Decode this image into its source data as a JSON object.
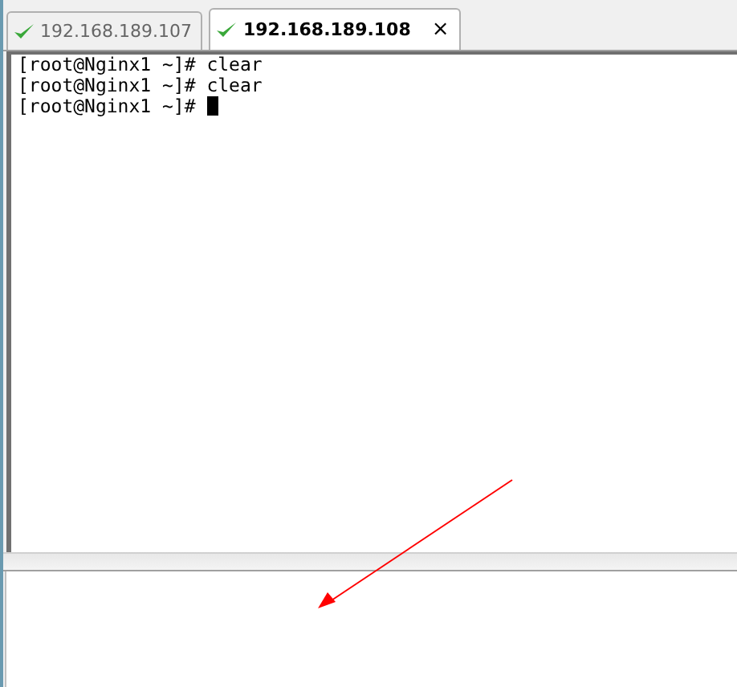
{
  "tabs": [
    {
      "label": "192.168.189.107",
      "selected": false
    },
    {
      "label": "192.168.189.108",
      "selected": true,
      "close": "×"
    }
  ],
  "terminal": {
    "lines": [
      "[root@Nginx1 ~]# clear",
      "[root@Nginx1 ~]# clear",
      "[root@Nginx1 ~]# "
    ],
    "cursor": true
  }
}
